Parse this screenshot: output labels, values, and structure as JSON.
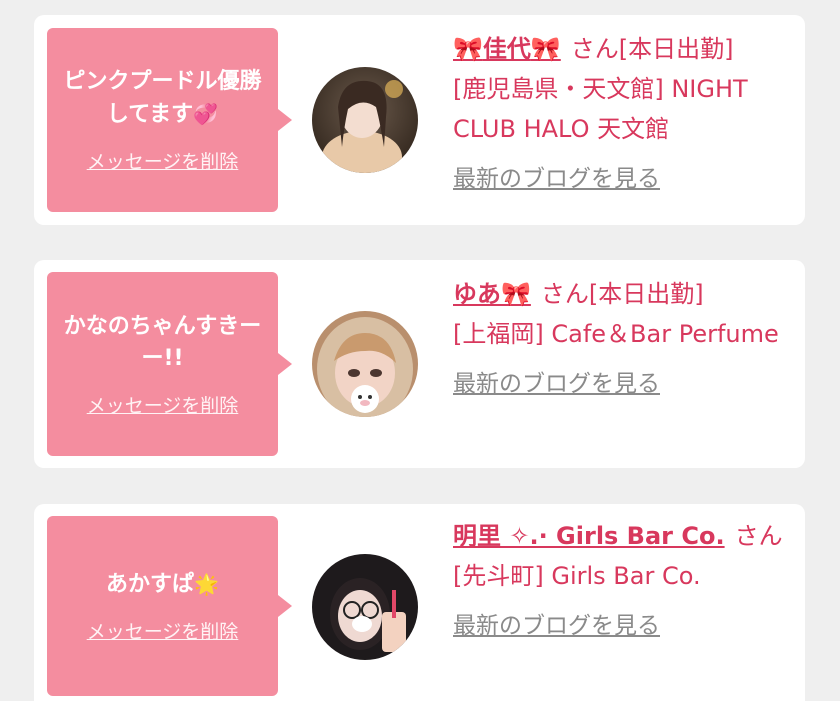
{
  "cards": [
    {
      "message": "ピンクプードル優勝してます",
      "message_emoji": "💞",
      "delete_label": "メッセージを削除",
      "name_prefix": "🎀",
      "name": "佳代",
      "name_suffix_icon": "🎀",
      "honorific": "さん",
      "status": "[本日出勤]",
      "location": "[鹿児島県・天文館] NIGHT CLUB HALO 天文館",
      "blog_label": "最新のブログを見る"
    },
    {
      "message": "かなのちゃんすきーー!!",
      "message_emoji": "",
      "delete_label": "メッセージを削除",
      "name_prefix": "",
      "name": "ゆあ",
      "name_suffix_icon": "🎀",
      "honorific": "さん",
      "status": "[本日出勤]",
      "location": "[上福岡] Cafe＆Bar Perfume",
      "blog_label": "最新のブログを見る"
    },
    {
      "message": "あかすぱ",
      "message_emoji": "🌟",
      "delete_label": "メッセージを削除",
      "name_prefix": "",
      "name": "明里 ✧.· Girls Bar Co.",
      "name_suffix_icon": "",
      "honorific": "さん",
      "status": "",
      "location": "[先斗町] Girls Bar Co.",
      "blog_label": "最新のブログを見る"
    }
  ],
  "colors": {
    "bubble": "#f48d9f",
    "accent": "#d8385d",
    "blog_link": "#8a8a8a",
    "background": "#efefef"
  }
}
